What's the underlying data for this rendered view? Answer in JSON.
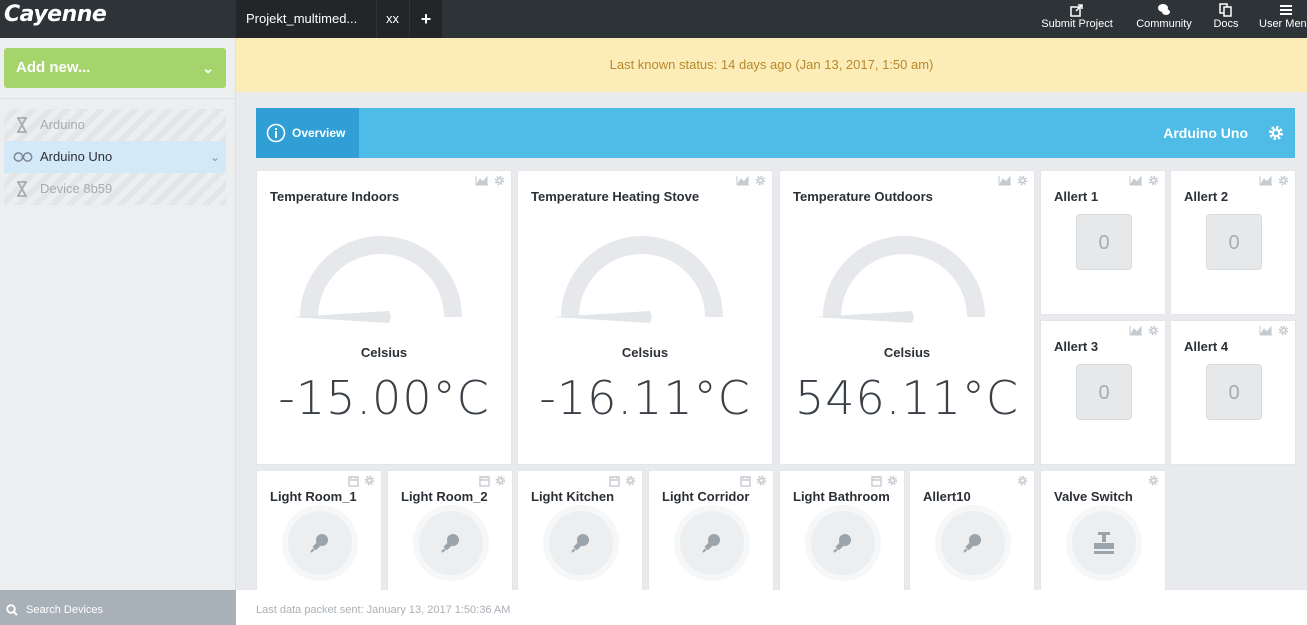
{
  "app": {
    "logo": "Cayenne"
  },
  "tabs": [
    {
      "label": "Projekt_multimed..."
    },
    {
      "label": "xx"
    }
  ],
  "nav": [
    {
      "label": "Submit Project",
      "icon": "share-icon"
    },
    {
      "label": "Community",
      "icon": "chat-icon"
    },
    {
      "label": "Docs",
      "icon": "docs-icon"
    },
    {
      "label": "User Men",
      "icon": "menu-icon"
    }
  ],
  "sidebar": {
    "add_new": "Add new...",
    "devices": [
      {
        "label": "Arduino",
        "icon": "hourglass-icon"
      },
      {
        "label": "Arduino Uno",
        "icon": "link-icon"
      },
      {
        "label": "Device 8b59",
        "icon": "hourglass-icon"
      }
    ],
    "search_label": "Search Devices"
  },
  "status": "Last known status: 14 days ago (Jan 13, 2017, 1:50 am)",
  "overview": {
    "tab": "Overview",
    "device": "Arduino Uno"
  },
  "gauges": [
    {
      "title": "Temperature Indoors",
      "unit": "Celsius",
      "value": "-15.00°C"
    },
    {
      "title": "Temperature Heating Stove",
      "unit": "Celsius",
      "value": "-16.11°C"
    },
    {
      "title": "Temperature Outdoors",
      "unit": "Celsius",
      "value": "546.11°C"
    }
  ],
  "alerts": [
    {
      "title": "Allert 1",
      "value": "0"
    },
    {
      "title": "Allert 2",
      "value": "0"
    },
    {
      "title": "Allert 3",
      "value": "0"
    },
    {
      "title": "Allert 4",
      "value": "0"
    }
  ],
  "actuators": [
    {
      "title": "Light Room_1",
      "icon": "bulb-icon"
    },
    {
      "title": "Light Room_2",
      "icon": "bulb-icon"
    },
    {
      "title": "Light Kitchen",
      "icon": "bulb-icon"
    },
    {
      "title": "Light Corridor",
      "icon": "bulb-icon"
    },
    {
      "title": "Light Bathroom",
      "icon": "bulb-icon"
    },
    {
      "title": "Allert10",
      "icon": "bulb-icon"
    },
    {
      "title": "Valve Switch",
      "icon": "valve-icon"
    }
  ],
  "footer": "Last data packet sent: January 13, 2017 1:50:36 AM",
  "colors": {
    "topbar": "#2e3338",
    "accent": "#4fbce7",
    "accent_dark": "#2f9fd6",
    "add_new": "#a4d46b",
    "status_bg": "#fcecb7",
    "status_text": "#b7892f"
  }
}
